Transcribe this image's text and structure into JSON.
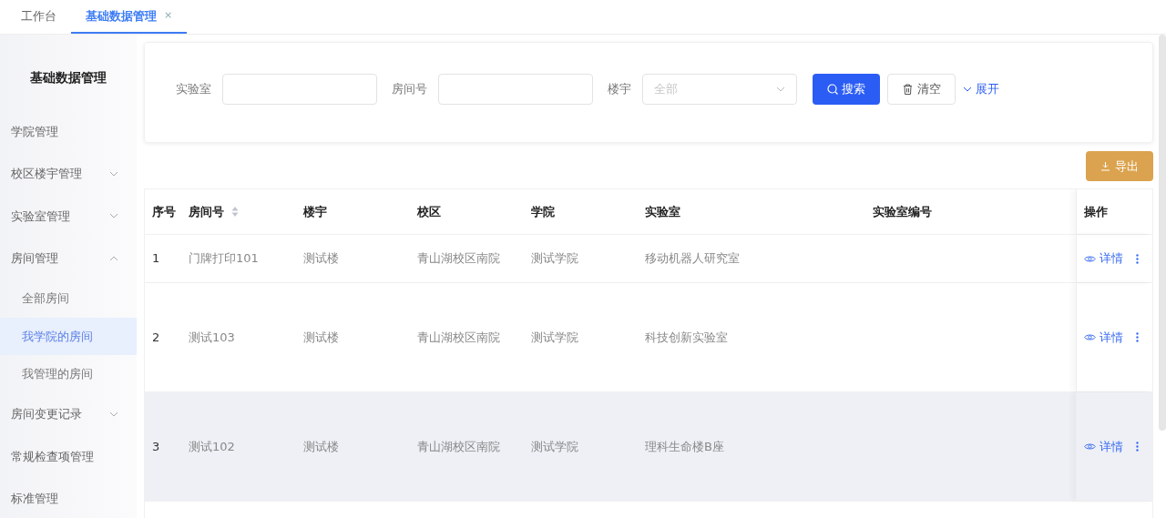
{
  "tabs": [
    {
      "label": "工作台",
      "selected": false
    },
    {
      "label": "基础数据管理",
      "selected": true,
      "close": "×"
    }
  ],
  "sidebar": {
    "title": "基础数据管理",
    "items": [
      {
        "kind": "link",
        "label": "学院管理",
        "selected": false
      },
      {
        "kind": "group",
        "label": "校区楼宇管理",
        "expanded": false
      },
      {
        "kind": "group",
        "label": "实验室管理",
        "expanded": false
      },
      {
        "kind": "group",
        "label": "房间管理",
        "expanded": true,
        "children": [
          {
            "label": "全部房间",
            "selected": false
          },
          {
            "label": "我学院的房间",
            "selected": true
          },
          {
            "label": "我管理的房间",
            "selected": false
          }
        ]
      },
      {
        "kind": "group",
        "label": "房间变更记录",
        "expanded": false
      },
      {
        "kind": "link",
        "label": "常规检查项管理",
        "selected": false
      },
      {
        "kind": "link",
        "label": "标准管理",
        "selected": false
      }
    ]
  },
  "filters": [
    {
      "kind": "text",
      "label": "实验室"
    },
    {
      "kind": "text",
      "label": "房间号"
    },
    {
      "kind": "select",
      "label": "楼宇",
      "placeholder": "全部"
    }
  ],
  "buttons": {
    "search": "搜索",
    "clear": "清空",
    "expand": "展开",
    "export": "导出"
  },
  "table": {
    "columns": [
      {
        "label": "序号",
        "sortable": false
      },
      {
        "label": "房间号",
        "sortable": true
      },
      {
        "label": "楼宇",
        "sortable": false
      },
      {
        "label": "校区",
        "sortable": false
      },
      {
        "label": "学院",
        "sortable": false
      },
      {
        "label": "实验室",
        "sortable": false
      },
      {
        "label": "实验室编号",
        "sortable": false
      },
      {
        "label": "操作",
        "sortable": false
      }
    ],
    "rows": [
      {
        "cells": [
          "1",
          "门牌打印101",
          "测试楼",
          "青山湖校区南院",
          "测试学院",
          "移动机器人研究室"
        ],
        "action": "详情",
        "highlighted": false
      },
      {
        "cells": [
          "2",
          "测试103",
          "测试楼",
          "青山湖校区南院",
          "测试学院",
          "科技创新实验室"
        ],
        "action": "详情",
        "highlighted": false
      },
      {
        "cells": [
          "3",
          "测试102",
          "测试楼",
          "青山湖校区南院",
          "测试学院",
          "理科生命楼B座"
        ],
        "action": "详情",
        "highlighted": true
      }
    ]
  }
}
